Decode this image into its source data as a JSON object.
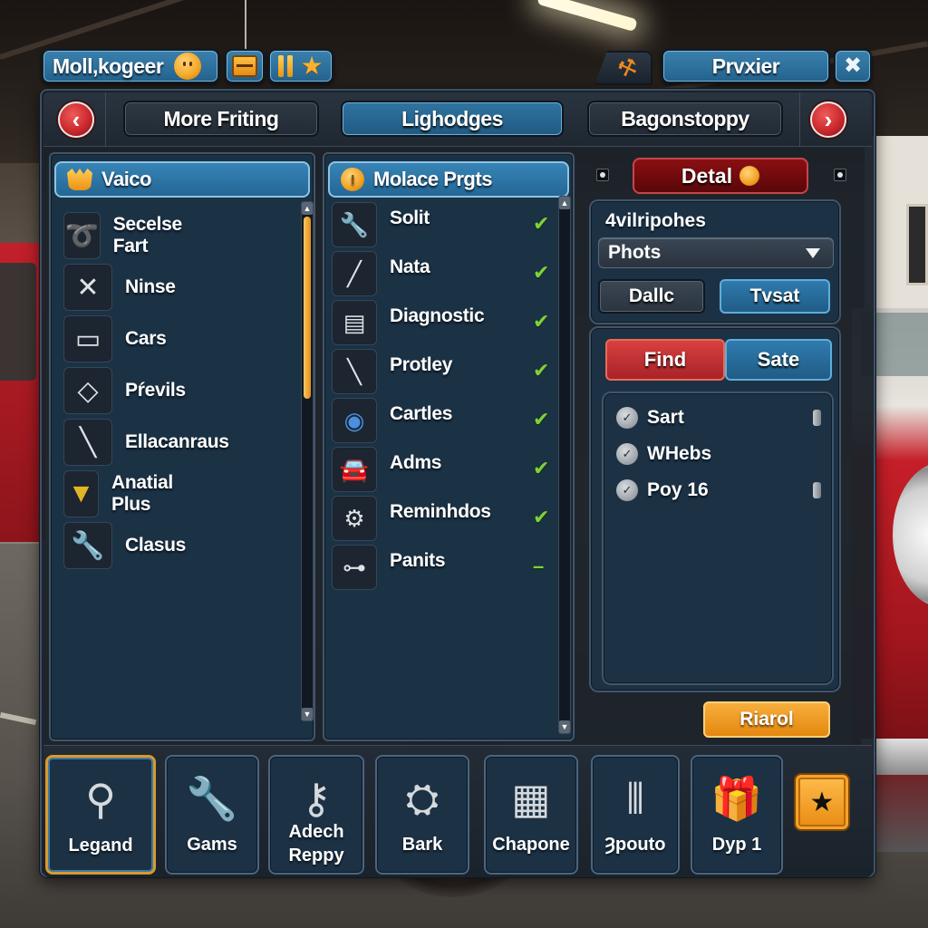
{
  "hud": {
    "player_name": "Moll,kogeer",
    "right_title": "Prvxier"
  },
  "tabs": [
    {
      "label": "More Friting",
      "active": false
    },
    {
      "label": "Lighodges",
      "active": true
    },
    {
      "label": "Bagonstoppy",
      "active": false
    }
  ],
  "left_column": {
    "title": "Vaico",
    "items": [
      {
        "label": "Secelse Fart",
        "icon": "tool-clamp-icon"
      },
      {
        "label": "Ninse",
        "icon": "crossed-tools-icon"
      },
      {
        "label": "Cars",
        "icon": "car-part-icon"
      },
      {
        "label": "Pŕevils",
        "icon": "ring-icon"
      },
      {
        "label": "Ellacanraus",
        "icon": "screwdriver-icon"
      },
      {
        "label": "Anatial Plus",
        "icon": "gold-emblem-icon"
      },
      {
        "label": "Clasus",
        "icon": "wrench-icon"
      }
    ],
    "scroll_position": 0.0,
    "scroll_visible_fraction": 0.37
  },
  "middle_column": {
    "title": "Molace Prgts",
    "items": [
      {
        "label": "Solit",
        "icon": "wrench-icon",
        "status": "done"
      },
      {
        "label": "Nata",
        "icon": "blade-icon",
        "status": "done"
      },
      {
        "label": "Diagnostic",
        "icon": "diagnostic-kit-icon",
        "status": "done"
      },
      {
        "label": "Protley",
        "icon": "spanner-icon",
        "status": "done"
      },
      {
        "label": "Cartles",
        "icon": "compass-icon",
        "status": "done"
      },
      {
        "label": "Adms",
        "icon": "car-icon",
        "status": "done"
      },
      {
        "label": "Reminhdos",
        "icon": "engine-icon",
        "status": "done"
      },
      {
        "label": "Panits",
        "icon": "spark-plug-icon",
        "status": "pending"
      }
    ],
    "status_glyphs": {
      "done": "✔",
      "pending": "–"
    }
  },
  "detail": {
    "title": "Detal",
    "section_title": "4vilripohes",
    "dropdown_value": "Phots",
    "button_left": "Dallc",
    "button_right": "Tvsat",
    "find_label": "Find",
    "sate_label": "Sate",
    "options": [
      {
        "label": "Sart",
        "toggle": true
      },
      {
        "label": "WHebs",
        "toggle": false
      },
      {
        "label": "Poy 16",
        "toggle": true
      }
    ],
    "action_label": "Riarol"
  },
  "bottom_slots": [
    {
      "label": "Legand",
      "icon": "magnifier-tool-icon",
      "selected": true
    },
    {
      "label": "Gams",
      "icon": "wrench-icon",
      "selected": false
    },
    {
      "label": "Adech Reppy",
      "icon": "socket-wrench-icon",
      "selected": false
    },
    {
      "label": "Bark",
      "icon": "piston-icon",
      "selected": false
    },
    {
      "label": "Chapone",
      "icon": "monitor-icon",
      "selected": false
    },
    {
      "label": "Ȝpouto",
      "icon": "exhaust-icon",
      "selected": false
    },
    {
      "label": "Dyp 1",
      "icon": "gift-box-icon",
      "selected": false
    }
  ]
}
